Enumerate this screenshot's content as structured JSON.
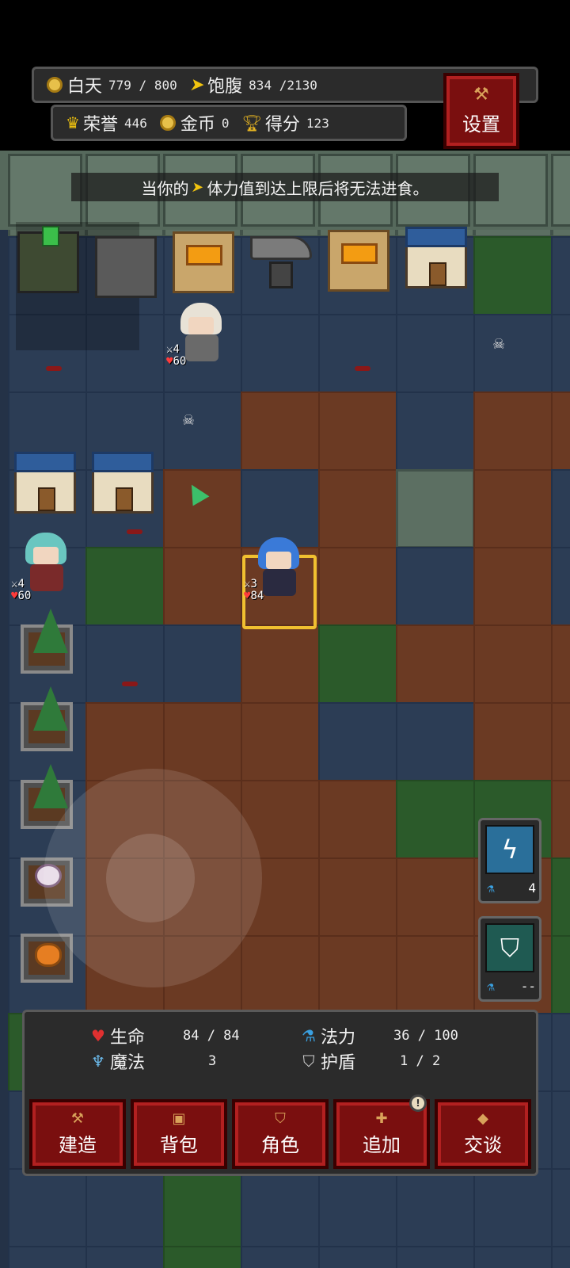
{
  "hud": {
    "day_label": "白天",
    "day_value": "779 / 800",
    "hunger_label": "饱腹",
    "hunger_value": "834 /2130",
    "honor_label": "荣誉",
    "honor_value": "446",
    "gold_label": "金币",
    "gold_value": "0",
    "score_label": "得分",
    "score_value": "123",
    "settings_label": "设置"
  },
  "hint": {
    "text_before": "当你的",
    "text_after": "体力值到达上限后将无法进食。"
  },
  "units": {
    "elder": {
      "attack": "4",
      "hp": "60"
    },
    "ally_girl": {
      "attack": "4",
      "hp": "60"
    },
    "hero": {
      "attack": "3",
      "hp": "84"
    }
  },
  "skills": [
    {
      "icon": "lightning-rune-icon",
      "cost": "4"
    },
    {
      "icon": "shield-rune-icon",
      "cost": "--"
    }
  ],
  "status": {
    "life_label": "生命",
    "life_value": "84 / 84",
    "mana_label": "法力",
    "mana_value": "36 / 100",
    "magic_label": "魔法",
    "magic_value": "3",
    "armor_label": "护盾",
    "armor_value": "1 / 2"
  },
  "actions": {
    "build": "建造",
    "bag": "背包",
    "character": "角色",
    "add": "追加",
    "talk": "交谈",
    "add_notice": "!"
  },
  "colors": {
    "button_red": "#7a0f0f",
    "selection_gold": "#f0c030",
    "hp_red": "#ff3b3b",
    "mana_blue": "#3aa0e0"
  }
}
